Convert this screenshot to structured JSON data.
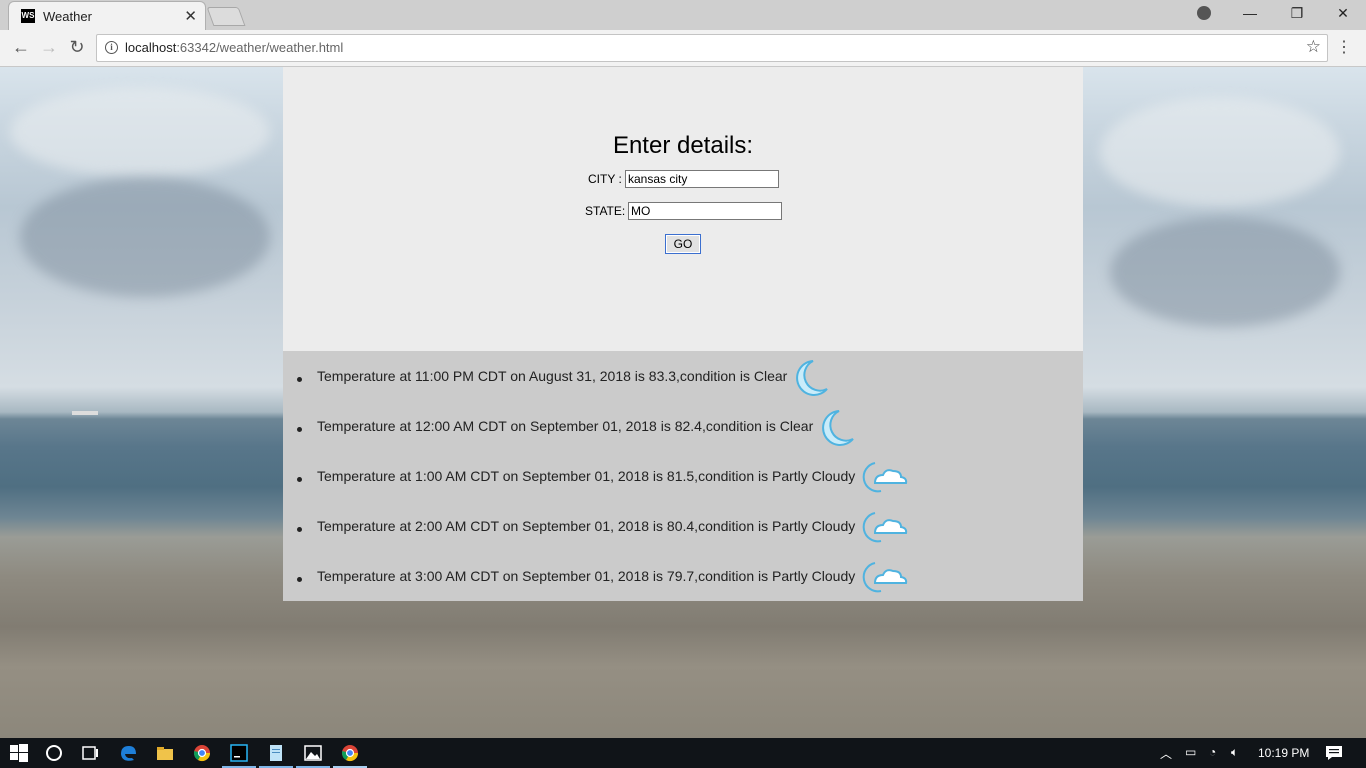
{
  "browser": {
    "tab_title": "Weather",
    "tab_favicon": "WS",
    "url_host": "localhost",
    "url_path": ":63342/weather/weather.html"
  },
  "form": {
    "title": "Enter details:",
    "city_label": "CITY :",
    "city_value": "kansas city",
    "state_label": "STATE:",
    "state_value": "MO",
    "go_label": "GO"
  },
  "results": [
    {
      "text": "Temperature at 11:00 PM CDT on August 31, 2018 is 83.3,condition is Clear",
      "icon": "moon-icon"
    },
    {
      "text": "Temperature at 12:00 AM CDT on September 01, 2018 is 82.4,condition is Clear",
      "icon": "moon-icon"
    },
    {
      "text": "Temperature at 1:00 AM CDT on September 01, 2018 is 81.5,condition is Partly Cloudy",
      "icon": "partly-cloudy-night-icon"
    },
    {
      "text": "Temperature at 2:00 AM CDT on September 01, 2018 is 80.4,condition is Partly Cloudy",
      "icon": "partly-cloudy-night-icon"
    },
    {
      "text": "Temperature at 3:00 AM CDT on September 01, 2018 is 79.7,condition is Partly Cloudy",
      "icon": "partly-cloudy-night-icon"
    }
  ],
  "taskbar": {
    "clock": "10:19 PM"
  },
  "colors": {
    "accent": "#3b6fcf",
    "icon_blue": "#5fc0e8"
  }
}
